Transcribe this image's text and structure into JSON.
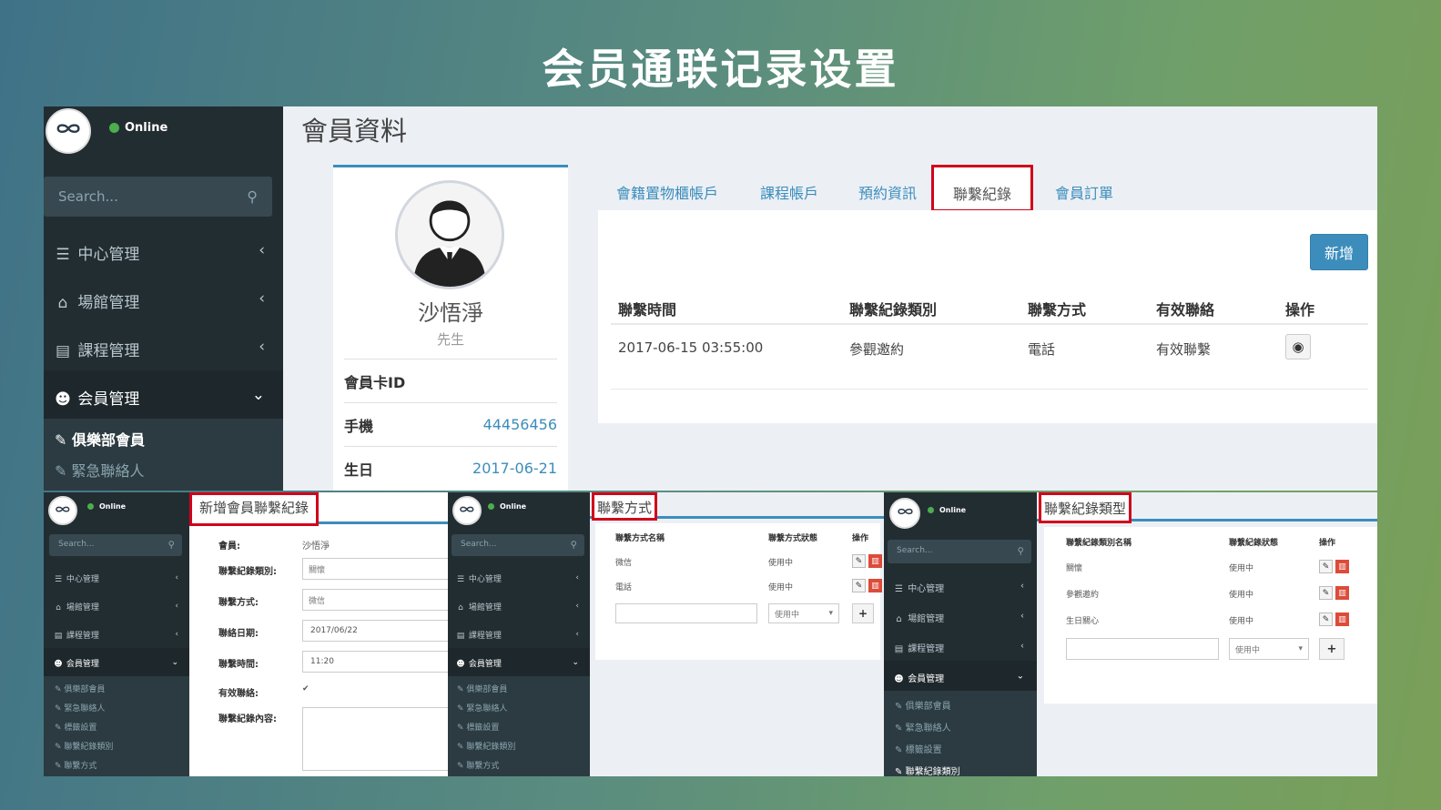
{
  "slide_title": "会员通联记录设置",
  "sidebar": {
    "status": "Online",
    "search_placeholder": "Search...",
    "menu": [
      {
        "label": "中心管理",
        "icon": "sitemap-icon"
      },
      {
        "label": "場館管理",
        "icon": "bank-icon"
      },
      {
        "label": "課程管理",
        "icon": "book-icon"
      },
      {
        "label": "会員管理",
        "icon": "users-icon"
      }
    ],
    "submenu_main": [
      "俱樂部會員",
      "緊急聯絡人"
    ],
    "submenu_small": [
      "俱樂部會員",
      "緊急聯絡人",
      "標籤設置",
      "聯繫紀錄類別",
      "聯繫方式"
    ]
  },
  "main": {
    "page_title": "會員資料",
    "profile": {
      "name": "沙悟淨",
      "title": "先生",
      "rows": [
        {
          "label": "會員卡ID",
          "value": ""
        },
        {
          "label": "手機",
          "value": "44456456"
        },
        {
          "label": "生日",
          "value": "2017-06-21"
        }
      ]
    },
    "tabs": [
      "會籍置物櫃帳戶",
      "課程帳戶",
      "預約資訊",
      "聯繫紀錄",
      "會員訂單"
    ],
    "active_tab": "聯繫紀錄",
    "add_button": "新增",
    "table": {
      "headers": [
        "聯繫時間",
        "聯繫紀錄類別",
        "聯繫方式",
        "有效聯絡",
        "操作"
      ],
      "rows": [
        [
          "2017-06-15 03:55:00",
          "參觀邀約",
          "電話",
          "有效聯繫"
        ]
      ]
    }
  },
  "panel_new_record": {
    "title": "新增會員聯繫紀錄",
    "fields": [
      {
        "label": "會員:",
        "value": "沙悟淨"
      },
      {
        "label": "聯繫紀錄類別:",
        "value": "關懷"
      },
      {
        "label": "聯繫方式:",
        "value": "微信"
      },
      {
        "label": "聯絡日期:",
        "value": "2017/06/22"
      },
      {
        "label": "聯繫時間:",
        "value": "11:20"
      },
      {
        "label": "有效聯絡:",
        "value": "✔"
      },
      {
        "label": "聯繫紀錄內容:",
        "value": ""
      }
    ]
  },
  "panel_methods": {
    "title": "聯繫方式",
    "headers": [
      "聯繫方式名稱",
      "聯繫方式狀態",
      "操作"
    ],
    "rows": [
      [
        "微信",
        "使用中"
      ],
      [
        "電話",
        "使用中"
      ]
    ],
    "select_value": "使用中",
    "plus": "+"
  },
  "panel_types": {
    "title": "聯繫紀錄類型",
    "headers": [
      "聯繫紀錄類別名稱",
      "聯繫紀錄狀態",
      "操作"
    ],
    "rows": [
      [
        "關懷",
        "使用中"
      ],
      [
        "參觀邀約",
        "使用中"
      ],
      [
        "生日關心",
        "使用中"
      ]
    ],
    "select_value": "使用中",
    "plus": "+"
  },
  "colors": {
    "accent": "#3c8dbc",
    "highlight": "#d0021b",
    "sidebar": "#222d32",
    "danger": "#dd4b39"
  }
}
